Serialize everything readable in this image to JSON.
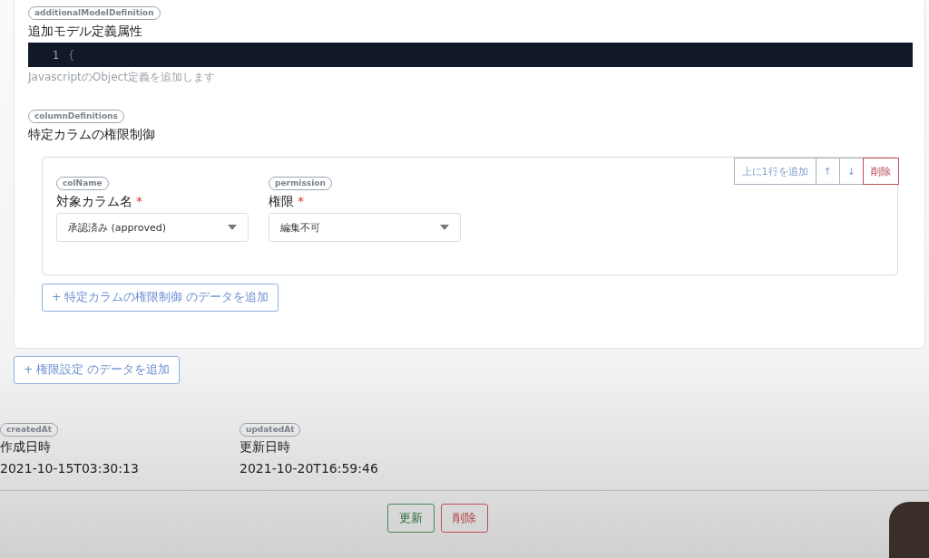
{
  "sections": [
    {
      "kind": "code",
      "key": "additionalModelDefinition",
      "label": "追加モデル定義属性",
      "code_lines": [
        {
          "number": "1",
          "text": "{"
        }
      ],
      "help": "JavascriptのObject定義を追加します"
    },
    {
      "kind": "list",
      "key": "columnDefinitions",
      "label": "特定カラムの権限制御",
      "row_actions": [
        {
          "label": "上に1行を追加",
          "kind": "normal"
        },
        {
          "label": "↑",
          "kind": "normal"
        },
        {
          "label": "↓",
          "kind": "normal"
        },
        {
          "label": "削除",
          "kind": "danger"
        }
      ],
      "rows": [
        {
          "fields": [
            {
              "key": "colName",
              "label": "対象カラム名",
              "required": true,
              "required_mark": "*",
              "value": "承認済み (approved)"
            },
            {
              "key": "permission",
              "label": "権限",
              "required": true,
              "required_mark": "*",
              "value": "編集不可"
            }
          ]
        }
      ],
      "add_button": "+ 特定カラムの権限制御 のデータを追加"
    }
  ],
  "outer_add_button": "+ 権限設定 のデータを追加",
  "meta": [
    {
      "key": "createdAt",
      "label": "作成日時",
      "value": "2021-10-15T03:30:13"
    },
    {
      "key": "updatedAt",
      "label": "更新日時",
      "value": "2021-10-20T16:59:46"
    }
  ],
  "footer_buttons": [
    {
      "label": "更新",
      "kind": "primary"
    },
    {
      "label": "削除",
      "kind": "danger"
    }
  ]
}
